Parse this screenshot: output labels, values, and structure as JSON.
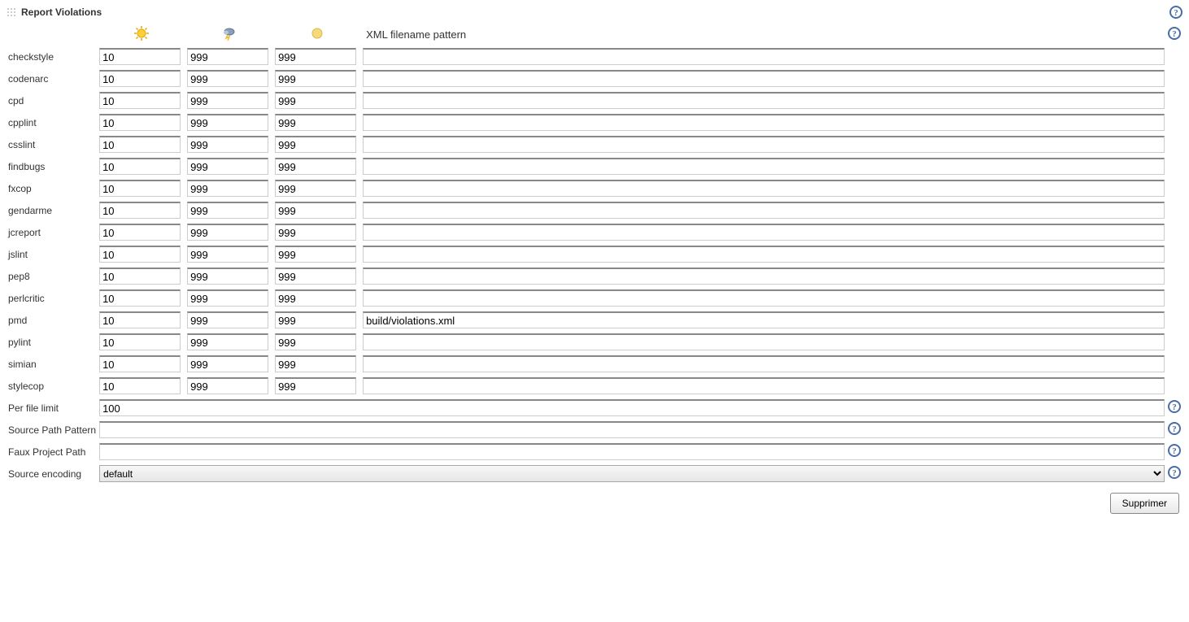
{
  "title": "Report Violations",
  "headers": {
    "xml_pattern": "XML filename pattern"
  },
  "rows": [
    {
      "name": "checkstyle",
      "v1": "10",
      "v2": "999",
      "v3": "999",
      "pattern": ""
    },
    {
      "name": "codenarc",
      "v1": "10",
      "v2": "999",
      "v3": "999",
      "pattern": ""
    },
    {
      "name": "cpd",
      "v1": "10",
      "v2": "999",
      "v3": "999",
      "pattern": ""
    },
    {
      "name": "cpplint",
      "v1": "10",
      "v2": "999",
      "v3": "999",
      "pattern": ""
    },
    {
      "name": "csslint",
      "v1": "10",
      "v2": "999",
      "v3": "999",
      "pattern": ""
    },
    {
      "name": "findbugs",
      "v1": "10",
      "v2": "999",
      "v3": "999",
      "pattern": ""
    },
    {
      "name": "fxcop",
      "v1": "10",
      "v2": "999",
      "v3": "999",
      "pattern": ""
    },
    {
      "name": "gendarme",
      "v1": "10",
      "v2": "999",
      "v3": "999",
      "pattern": ""
    },
    {
      "name": "jcreport",
      "v1": "10",
      "v2": "999",
      "v3": "999",
      "pattern": ""
    },
    {
      "name": "jslint",
      "v1": "10",
      "v2": "999",
      "v3": "999",
      "pattern": ""
    },
    {
      "name": "pep8",
      "v1": "10",
      "v2": "999",
      "v3": "999",
      "pattern": ""
    },
    {
      "name": "perlcritic",
      "v1": "10",
      "v2": "999",
      "v3": "999",
      "pattern": ""
    },
    {
      "name": "pmd",
      "v1": "10",
      "v2": "999",
      "v3": "999",
      "pattern": "build/violations.xml"
    },
    {
      "name": "pylint",
      "v1": "10",
      "v2": "999",
      "v3": "999",
      "pattern": ""
    },
    {
      "name": "simian",
      "v1": "10",
      "v2": "999",
      "v3": "999",
      "pattern": ""
    },
    {
      "name": "stylecop",
      "v1": "10",
      "v2": "999",
      "v3": "999",
      "pattern": ""
    }
  ],
  "footer": {
    "per_file_limit_label": "Per file limit",
    "per_file_limit_value": "100",
    "source_path_label": "Source Path Pattern",
    "source_path_value": "",
    "faux_project_label": "Faux Project Path",
    "faux_project_value": "",
    "source_encoding_label": "Source encoding",
    "source_encoding_value": "default"
  },
  "buttons": {
    "delete": "Supprimer"
  }
}
